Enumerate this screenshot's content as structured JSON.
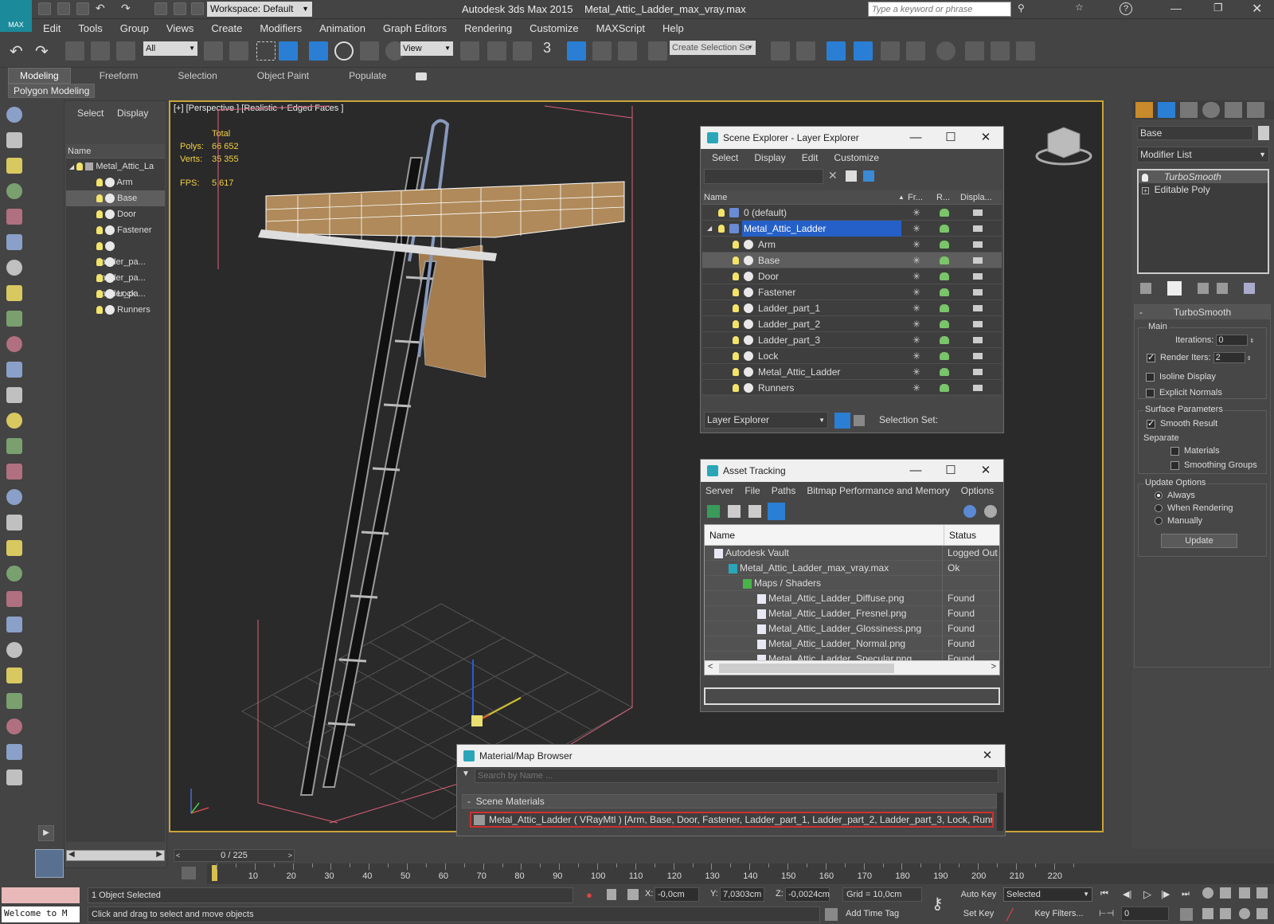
{
  "app": {
    "title": "Autodesk 3ds Max  2015",
    "file": "Metal_Attic_Ladder_max_vray.max",
    "logo": "MAX",
    "workspace": "Workspace: Default",
    "search_placeholder": "Type a keyword or phrase"
  },
  "menu": [
    "Edit",
    "Tools",
    "Group",
    "Views",
    "Create",
    "Modifiers",
    "Animation",
    "Graph Editors",
    "Rendering",
    "Customize",
    "MAXScript",
    "Help"
  ],
  "toolbar": {
    "filter": "All",
    "view": "View",
    "selection_set": "Create Selection Se",
    "snap3": "3"
  },
  "ribbon": {
    "tabs": [
      "Modeling",
      "Freeform",
      "Selection",
      "Object Paint",
      "Populate"
    ],
    "sub": "Polygon Modeling"
  },
  "scene_panel": {
    "tabs": [
      "Select",
      "Display"
    ],
    "header": "Name",
    "root": "Metal_Attic_La",
    "items": [
      "Arm",
      "Base",
      "Door",
      "Fastener",
      "Ladder_pa...",
      "Ladder_pa...",
      "Ladder_pa...",
      "Lock",
      "Runners"
    ],
    "selected": "Base"
  },
  "viewport": {
    "label": "[+] [Perspective ] [Realistic + Edged Faces ]",
    "stats": {
      "total": "Total",
      "polys_label": "Polys:",
      "polys": "66 652",
      "verts_label": "Verts:",
      "verts": "35 355",
      "fps_label": "FPS:",
      "fps": "5,617"
    }
  },
  "layer_explorer": {
    "title": "Scene Explorer - Layer Explorer",
    "menu": [
      "Select",
      "Display",
      "Edit",
      "Customize"
    ],
    "cols": [
      "Name",
      "Fr...",
      "R...",
      "Displa..."
    ],
    "rows": [
      {
        "name": "0 (default)",
        "level": 0
      },
      {
        "name": "Metal_Attic_Ladder",
        "level": 0,
        "selected": true
      },
      {
        "name": "Arm",
        "level": 1
      },
      {
        "name": "Base",
        "level": 1,
        "highlight": true
      },
      {
        "name": "Door",
        "level": 1
      },
      {
        "name": "Fastener",
        "level": 1
      },
      {
        "name": "Ladder_part_1",
        "level": 1
      },
      {
        "name": "Ladder_part_2",
        "level": 1
      },
      {
        "name": "Ladder_part_3",
        "level": 1
      },
      {
        "name": "Lock",
        "level": 1
      },
      {
        "name": "Metal_Attic_Ladder",
        "level": 1
      },
      {
        "name": "Runners",
        "level": 1
      }
    ],
    "footer_dropdown": "Layer Explorer",
    "footer_label": "Selection Set:"
  },
  "asset_tracking": {
    "title": "Asset Tracking",
    "menu": [
      "Server",
      "File",
      "Paths",
      "Bitmap Performance and Memory",
      "Options"
    ],
    "cols": [
      "Name",
      "Status"
    ],
    "rows": [
      {
        "name": "Autodesk Vault",
        "status": "Logged Out",
        "indent": 1
      },
      {
        "name": "Metal_Attic_Ladder_max_vray.max",
        "status": "Ok",
        "indent": 2
      },
      {
        "name": "Maps / Shaders",
        "status": "",
        "indent": 3
      },
      {
        "name": "Metal_Attic_Ladder_Diffuse.png",
        "status": "Found",
        "indent": 4
      },
      {
        "name": "Metal_Attic_Ladder_Fresnel.png",
        "status": "Found",
        "indent": 4
      },
      {
        "name": "Metal_Attic_Ladder_Glossiness.png",
        "status": "Found",
        "indent": 4
      },
      {
        "name": "Metal_Attic_Ladder_Normal.png",
        "status": "Found",
        "indent": 4
      },
      {
        "name": "Metal_Attic_Ladder_Specular.png",
        "status": "Found",
        "indent": 4
      }
    ]
  },
  "material_browser": {
    "title": "Material/Map Browser",
    "search_placeholder": "Search by Name ...",
    "section": "Scene Materials",
    "item": "Metal_Attic_Ladder  ( VRayMtl ) [Arm, Base, Door, Fastener, Ladder_part_1, Ladder_part_2, Ladder_part_3, Lock, Runners]"
  },
  "modifier_panel": {
    "object_name": "Base",
    "modifier_list": "Modifier List",
    "stack": [
      "TurboSmooth",
      "Editable Poly"
    ],
    "rollout": "TurboSmooth",
    "main": "Main",
    "iterations_label": "Iterations:",
    "iterations": "0",
    "render_iters_label": "Render Iters:",
    "render_iters": "2",
    "isoline": "Isoline Display",
    "explicit": "Explicit Normals",
    "surface": "Surface Parameters",
    "smooth_result": "Smooth Result",
    "separate": "Separate",
    "materials": "Materials",
    "smoothing_groups": "Smoothing Groups",
    "update_options": "Update Options",
    "always": "Always",
    "when_rendering": "When Rendering",
    "manually": "Manually",
    "update_btn": "Update"
  },
  "timeline": {
    "counter": "0 / 225",
    "ticks": [
      "10",
      "20",
      "30",
      "40",
      "50",
      "60",
      "70",
      "80",
      "90",
      "100",
      "110",
      "120",
      "130",
      "140",
      "150",
      "160",
      "170",
      "180",
      "190",
      "200",
      "210",
      "220"
    ]
  },
  "status": {
    "welcome": "Welcome to M",
    "selected": "1 Object Selected",
    "hint": "Click and drag to select and move objects",
    "x_label": "X:",
    "x": "-0,0cm",
    "y_label": "Y:",
    "y": "7,0303cm",
    "z_label": "Z:",
    "z": "-0,0024cm",
    "grid": "Grid = 10,0cm",
    "auto_key": "Auto Key",
    "set_key": "Set Key",
    "key_mode": "Selected",
    "key_filters": "Key Filters...",
    "add_time_tag": "Add Time Tag",
    "frame": "0"
  },
  "colors": {
    "accent": "#2a7fd4",
    "selected_row": "#2560c8",
    "viewport_bg": "#2a2a2a",
    "wood": "#a47c4e"
  }
}
